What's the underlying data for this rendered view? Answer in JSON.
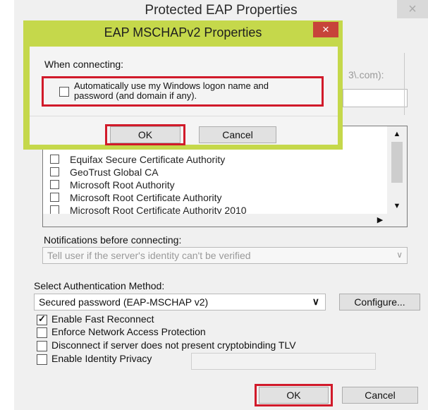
{
  "outer": {
    "title": "Protected EAP Properties",
    "close_symbol": "×",
    "server_field_partial": "3\\.com):",
    "ca_items": [
      "Equifax Secure Certificate Authority",
      "GeoTrust Global CA",
      "Microsoft Root Authority",
      "Microsoft Root Certificate Authority",
      "Microsoft Root Certificate Authority 2010"
    ],
    "notifications_label": "Notifications before connecting:",
    "notifications_value": "Tell user if the server's identity can't be verified",
    "auth_method_label": "Select Authentication Method:",
    "auth_method_value": "Secured password (EAP-MSCHAP v2)",
    "configure_label": "Configure...",
    "options": [
      {
        "label": "Enable Fast Reconnect",
        "checked": true
      },
      {
        "label": "Enforce Network Access Protection",
        "checked": false
      },
      {
        "label": "Disconnect if server does not present cryptobinding TLV",
        "checked": false
      },
      {
        "label": "Enable Identity Privacy",
        "checked": false
      }
    ],
    "ok_label": "OK",
    "cancel_label": "Cancel"
  },
  "inner": {
    "title": "EAP MSCHAPv2 Properties",
    "close_symbol": "×",
    "when_connecting": "When connecting:",
    "auto_logon_line1": "Automatically use my Windows logon name and",
    "auto_logon_line2": "password (and domain if any).",
    "auto_logon_checked": false,
    "ok_label": "OK",
    "cancel_label": "Cancel"
  },
  "colors": {
    "highlight_red": "#d11a2a",
    "inner_frame": "#c5d84b",
    "inner_close": "#c7443a"
  }
}
